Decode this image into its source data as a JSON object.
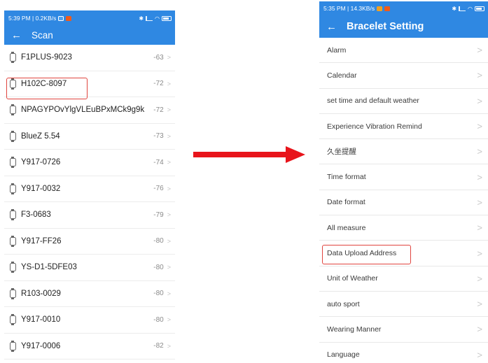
{
  "scan_screen": {
    "status_time": "5:39 PM | 0.2KB/s",
    "title": "Scan",
    "devices": [
      {
        "name": "F1PLUS-9023",
        "rssi": "-63"
      },
      {
        "name": "H102C-8097",
        "rssi": "-72"
      },
      {
        "name": "NPAGYPOvYlgVLEuBPxMCk9g9k",
        "rssi": "-72"
      },
      {
        "name": "BlueZ 5.54",
        "rssi": "-73"
      },
      {
        "name": "Y917-0726",
        "rssi": "-74"
      },
      {
        "name": "Y917-0032",
        "rssi": "-76"
      },
      {
        "name": "F3-0683",
        "rssi": "-79"
      },
      {
        "name": "Y917-FF26",
        "rssi": "-80"
      },
      {
        "name": "YS-D1-5DFE03",
        "rssi": "-80"
      },
      {
        "name": "R103-0029",
        "rssi": "-80"
      },
      {
        "name": "Y917-0010",
        "rssi": "-80"
      },
      {
        "name": "Y917-0006",
        "rssi": "-82"
      }
    ],
    "highlighted_device_index": 1
  },
  "settings_screen": {
    "status_time": "5:35 PM | 14.3KB/s",
    "title": "Bracelet Setting",
    "items": [
      "Alarm",
      "Calendar",
      "set time and default weather",
      "Experience Vibration Remind",
      "久坐提醒",
      "Time format",
      "Date format",
      "All measure",
      "Data Upload Address",
      "Unit of Weather",
      "auto sport",
      "Wearing Manner",
      "Language"
    ],
    "highlighted_item_index": 8
  },
  "icons": {
    "back": "arrow-left-icon",
    "device": "watch-icon",
    "row_chevron": "chevron-right-icon",
    "transition": "arrow-right-icon"
  },
  "colors": {
    "app_bar": "#2f88e2",
    "highlight": "#e0443e",
    "arrow": "#e8141b"
  }
}
